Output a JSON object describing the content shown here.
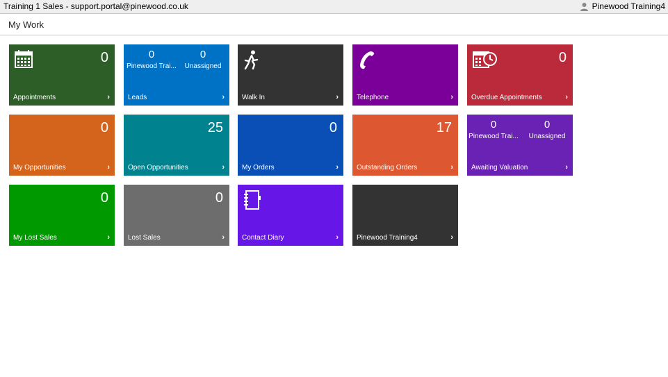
{
  "window": {
    "title": "Training 1 Sales - support.portal@pinewood.co.uk",
    "user_name": "Pinewood Training4"
  },
  "page": {
    "title": "My Work"
  },
  "tiles": {
    "appointments": {
      "label": "Appointments",
      "count": "0",
      "color": "#2e5e28",
      "icon": "calendar-icon"
    },
    "leads": {
      "label": "Leads",
      "left_value": "0",
      "left_label": "Pinewood Trai...",
      "right_value": "0",
      "right_label": "Unassigned",
      "color": "#0072c6"
    },
    "walk_in": {
      "label": "Walk In",
      "color": "#333333",
      "icon": "walking-person-icon"
    },
    "telephone": {
      "label": "Telephone",
      "color": "#7b0099",
      "icon": "phone-icon"
    },
    "overdue": {
      "label": "Overdue Appointments",
      "count": "0",
      "color": "#ba2a3a",
      "icon": "calendar-clock-icon"
    },
    "my_opportunities": {
      "label": "My Opportunities",
      "count": "0",
      "color": "#d4641c"
    },
    "open_opportunities": {
      "label": "Open Opportunities",
      "count": "25",
      "color": "#00828f"
    },
    "my_orders": {
      "label": "My Orders",
      "count": "0",
      "color": "#0a4fb5"
    },
    "outstanding_orders": {
      "label": "Outstanding Orders",
      "count": "17",
      "color": "#dd5830"
    },
    "awaiting_valuation": {
      "label": "Awaiting Valuation",
      "left_value": "0",
      "left_label": "Pinewood Trai...",
      "right_value": "0",
      "right_label": "Unassigned",
      "color": "#6a22b4"
    },
    "my_lost_sales": {
      "label": "My Lost Sales",
      "count": "0",
      "color": "#009a00"
    },
    "lost_sales": {
      "label": "Lost Sales",
      "count": "0",
      "color": "#6d6d6d"
    },
    "contact_diary": {
      "label": "Contact Diary",
      "color": "#6616e6",
      "icon": "notebook-icon"
    },
    "user_tile": {
      "label": "Pinewood Training4",
      "color": "#333333"
    }
  },
  "chevron": "›"
}
